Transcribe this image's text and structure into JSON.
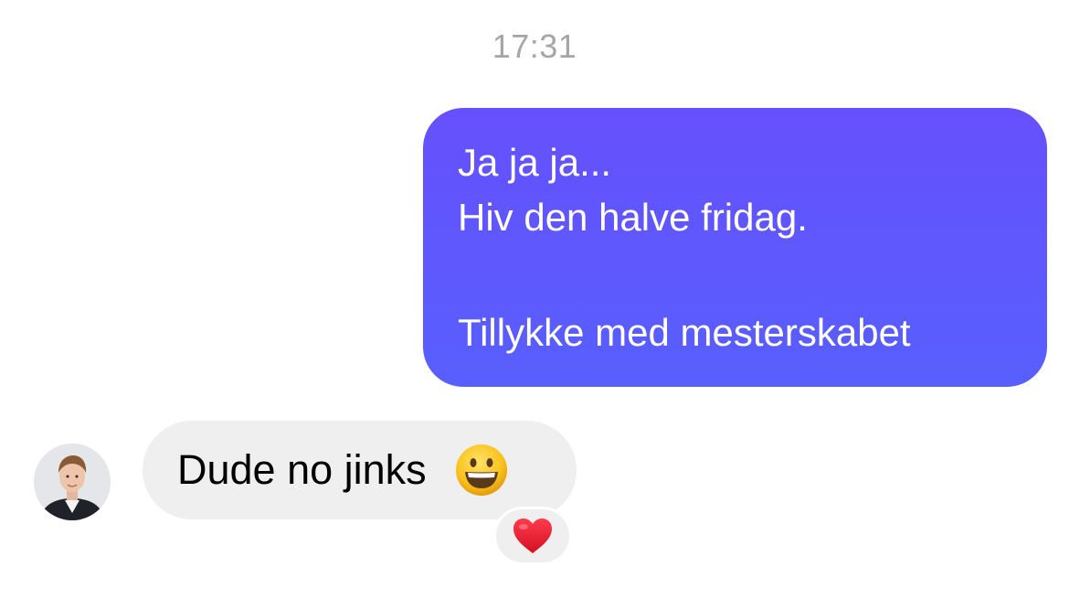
{
  "conversation": {
    "timestamp": "17:31",
    "outgoing": {
      "lines": [
        "Ja ja ja...",
        "Hiv den halve fridag.",
        "",
        "Tillykke med mesterskabet"
      ]
    },
    "incoming": {
      "text": "Dude no jinks",
      "emoji": "grinning-face-emoji",
      "reaction": "red-heart-emoji"
    }
  },
  "colors": {
    "outgoing_top": "#6650fd",
    "outgoing_bottom": "#585ffd",
    "incoming_bubble": "#efeff0",
    "timestamp": "#a6a6aa",
    "heart": "#e8122a"
  }
}
